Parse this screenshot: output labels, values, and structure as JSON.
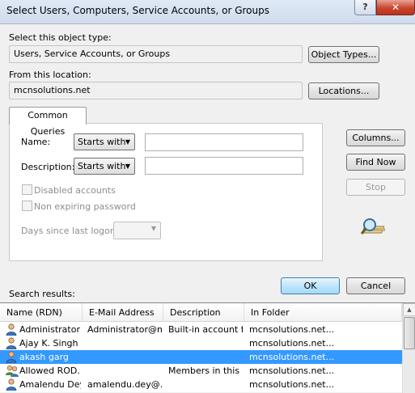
{
  "window": {
    "title": "Select Users, Computers, Service Accounts, or Groups",
    "help_glyph": "?",
    "close_glyph": "✕"
  },
  "object_type": {
    "label": "Select this object type:",
    "value": "Users, Service Accounts, or Groups",
    "button": "Object Types..."
  },
  "location": {
    "label": "From this location:",
    "value": "mcnsolutions.net",
    "button": "Locations..."
  },
  "queries": {
    "tab": "Common Queries",
    "name_label": "Name:",
    "name_mode": "Starts with",
    "name_value": "",
    "desc_label": "Description:",
    "desc_mode": "Starts with",
    "desc_value": "",
    "disabled_label": "Disabled accounts",
    "nonexpiring_label": "Non expiring password",
    "days_label": "Days since last logon:",
    "days_value": ""
  },
  "side_buttons": {
    "columns": "Columns...",
    "find_now": "Find Now",
    "stop": "Stop"
  },
  "actions": {
    "ok": "OK",
    "cancel": "Cancel"
  },
  "results": {
    "label": "Search results:",
    "columns": [
      "Name (RDN)",
      "E-Mail Address",
      "Description",
      "In Folder"
    ],
    "rows": [
      {
        "name": "Administrator",
        "email": "Administrator@m...",
        "description": "Built-in account f...",
        "folder": "mcnsolutions.net...",
        "icon": "user-icon"
      },
      {
        "name": "Ajay K. Singh",
        "email": "",
        "description": "",
        "folder": "mcnsolutions.net...",
        "icon": "user-icon"
      },
      {
        "name": "akash garg",
        "email": "",
        "description": "",
        "folder": "mcnsolutions.net...",
        "icon": "user-icon",
        "selected": true
      },
      {
        "name": "Allowed ROD...",
        "email": "",
        "description": "Members in this ...",
        "folder": "mcnsolutions.net...",
        "icon": "group-icon"
      },
      {
        "name": "Amalendu Dey",
        "email": "amalendu.dey@...",
        "description": "",
        "folder": "mcnsolutions.net...",
        "icon": "user-icon"
      }
    ]
  }
}
